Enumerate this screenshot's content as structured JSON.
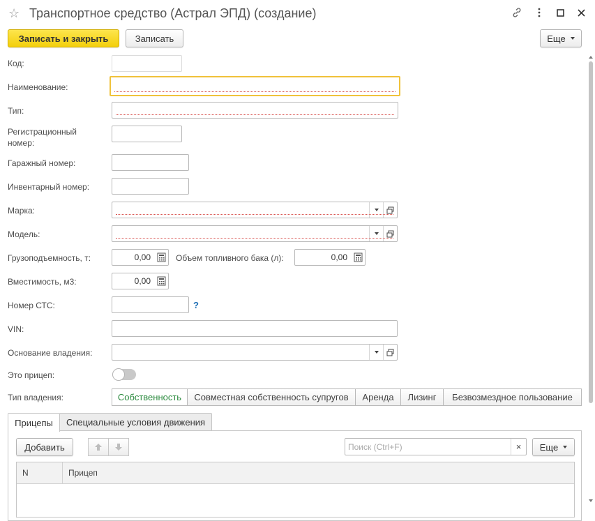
{
  "window": {
    "title": "Транспортное средство (Астрал ЭПД) (создание)",
    "icons": [
      "star-icon",
      "link-icon",
      "more-vertical-icon",
      "maximize-icon",
      "close-icon"
    ]
  },
  "toolbar": {
    "save_close_label": "Записать и закрыть",
    "save_label": "Записать",
    "more_label": "Еще"
  },
  "form": {
    "code_label": "Код:",
    "name_label": "Наименование:",
    "type_label": "Тип:",
    "reg_number_label_1": "Регистрационный",
    "reg_number_label_2": "номер:",
    "garage_number_label": "Гаражный номер:",
    "inventory_number_label": "Инвентарный номер:",
    "brand_label": "Марка:",
    "model_label": "Модель:",
    "capacity_label": "Грузоподъемность, т:",
    "capacity_value": "0,00",
    "fuel_tank_label": "Объем топливного бака (л):",
    "fuel_tank_value": "0,00",
    "volume_label": "Вместимость, м3:",
    "volume_value": "0,00",
    "sts_label": "Номер СТС:",
    "sts_help": "?",
    "vin_label": "VIN:",
    "ownership_basis_label": "Основание владения:",
    "is_trailer_label": "Это прицеп:",
    "ownership_type_label": "Тип владения:",
    "ownership_options": [
      "Собственность",
      "Совместная собственность супругов",
      "Аренда",
      "Лизинг",
      "Безвозмездное пользование"
    ],
    "ownership_selected": "Собственность"
  },
  "tabs": [
    {
      "label": "Прицепы",
      "active": true
    },
    {
      "label": "Специальные условия движения",
      "active": false
    }
  ],
  "trailers": {
    "add_label": "Добавить",
    "search_placeholder": "Поиск (Ctrl+F)",
    "clear_symbol": "×",
    "more_label": "Еще",
    "columns": [
      "N",
      "Прицеп"
    ],
    "rows": []
  },
  "colors": {
    "primary_button": "#f3cf0c",
    "focus_border": "#f0c23b",
    "selected_option": "#2b8a3e",
    "help_link": "#1f6fb5"
  }
}
